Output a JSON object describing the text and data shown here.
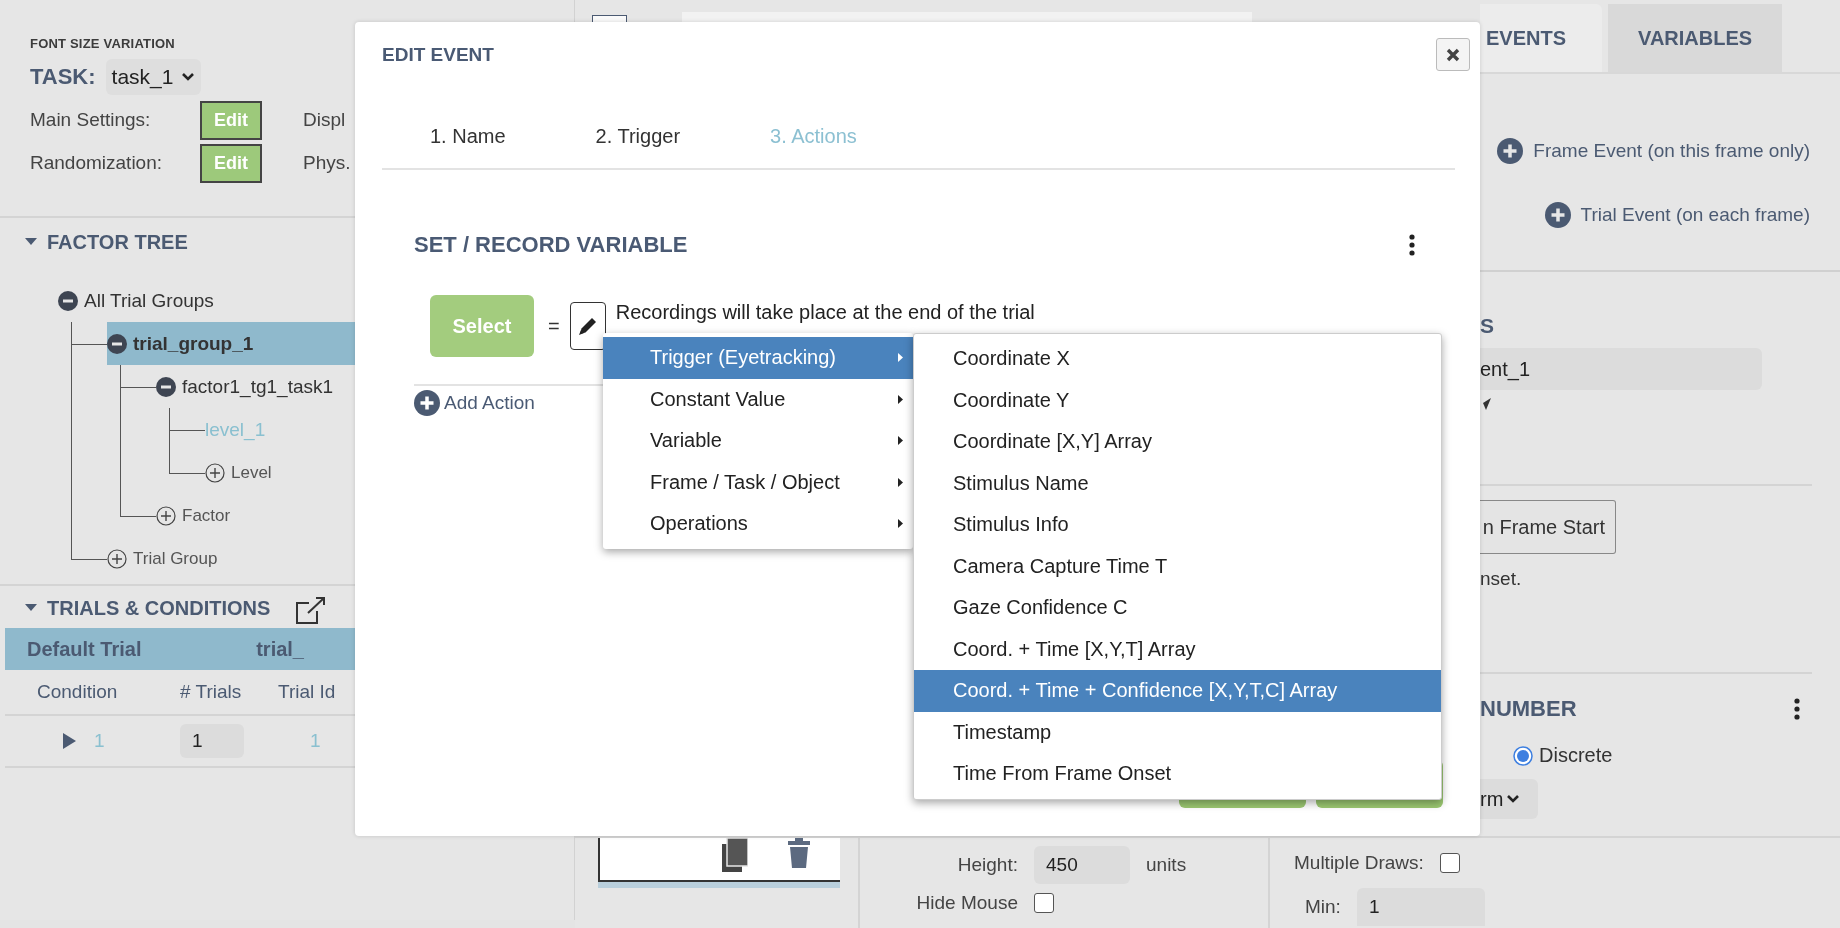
{
  "left_panel": {
    "title": "FONT SIZE VARIATION",
    "task_label": "TASK:",
    "task_value": "task_1",
    "settings": [
      {
        "label": "Main Settings:",
        "button": "Edit",
        "side_text": "Displ"
      },
      {
        "label": "Randomization:",
        "button": "Edit",
        "side_text": "Phys."
      }
    ],
    "factor_tree": {
      "title": "FACTOR TREE",
      "expanded": true,
      "nodes": [
        {
          "label": "All Trial Groups",
          "kind": "group",
          "expanded": true,
          "selected": false,
          "children": [
            {
              "label": "trial_group_1",
              "kind": "group",
              "expanded": true,
              "selected": true,
              "children": [
                {
                  "label": "factor1_tg1_task1",
                  "kind": "factor",
                  "expanded": true,
                  "selected": false,
                  "children": [
                    {
                      "label": "level_1",
                      "kind": "level",
                      "selected": false
                    },
                    {
                      "label": "Level",
                      "kind": "add"
                    }
                  ]
                },
                {
                  "label": "Factor",
                  "kind": "add"
                }
              ]
            },
            {
              "label": "Trial Group",
              "kind": "add"
            }
          ]
        }
      ]
    },
    "trials": {
      "title": "TRIALS & CONDITIONS",
      "expanded": true,
      "default_trial": "Default Trial",
      "default_trial_id": "trial_",
      "columns": [
        "Condition",
        "# Trials",
        "Trial Id"
      ],
      "rows": [
        {
          "condition": "1",
          "trials": "1",
          "trial_id": "1",
          "expanded": false
        }
      ]
    }
  },
  "right_panel": {
    "tabs": [
      {
        "label": "EVENTS",
        "selected": true
      },
      {
        "label": "VARIABLES",
        "selected": false
      }
    ],
    "add_buttons": [
      "Frame Event (on this frame only)",
      "Trial Event (on each frame)"
    ],
    "heading": "S",
    "name_value": "ent_1",
    "start_button": "n Frame Start",
    "note": "nset.",
    "section_title": "NUMBER",
    "radio": {
      "label": "Discrete",
      "selected": true
    },
    "select_value": "rm"
  },
  "bottom": {
    "height_label": "Height:",
    "height_value": "450",
    "height_unit": "units",
    "hide_mouse_label": "Hide Mouse",
    "hide_mouse_checked": false,
    "multiple_draws_label": "Multiple Draws:",
    "multiple_draws_checked": false,
    "min_label": "Min:",
    "min_value": "1"
  },
  "modal": {
    "title": "EDIT EVENT",
    "steps": [
      {
        "label": "1. Name",
        "selected": false
      },
      {
        "label": "2. Trigger",
        "selected": false
      },
      {
        "label": "3. Actions",
        "selected": true
      }
    ],
    "action_title": "SET / RECORD VARIABLE",
    "select_button": "Select",
    "equals": "=",
    "note": "Recordings will take place at the end of the trial",
    "add_action": "Add Action",
    "menu": [
      {
        "label": "Trigger (Eyetracking)",
        "selected": true
      },
      {
        "label": "Constant Value",
        "selected": false
      },
      {
        "label": "Variable",
        "selected": false
      },
      {
        "label": "Frame / Task / Object",
        "selected": false
      },
      {
        "label": "Operations",
        "selected": false
      }
    ],
    "submenu": [
      {
        "label": "Coordinate X",
        "selected": false
      },
      {
        "label": "Coordinate Y",
        "selected": false
      },
      {
        "label": "Coordinate [X,Y] Array",
        "selected": false
      },
      {
        "label": "Stimulus Name",
        "selected": false
      },
      {
        "label": "Stimulus Info",
        "selected": false
      },
      {
        "label": "Camera Capture Time T",
        "selected": false
      },
      {
        "label": "Gaze Confidence C",
        "selected": false
      },
      {
        "label": "Coord. + Time [X,Y,T] Array",
        "selected": false
      },
      {
        "label": "Coord. + Time + Confidence [X,Y,T,C] Array",
        "selected": true
      },
      {
        "label": "Timestamp",
        "selected": false
      },
      {
        "label": "Time From Frame Onset",
        "selected": false
      }
    ]
  }
}
